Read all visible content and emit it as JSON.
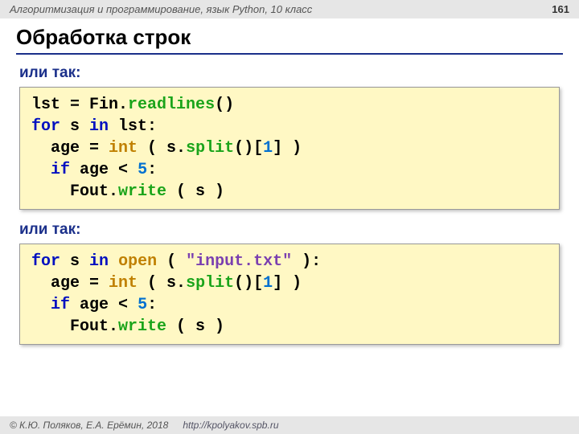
{
  "header": {
    "course": "Алгоритмизация и программирование, язык Python, 10 класс",
    "page": "161"
  },
  "title": "Обработка строк",
  "subtitle1": "или так:",
  "subtitle2": "или так:",
  "code1": {
    "l1a": "lst",
    "l1b": " = ",
    "l1c": "Fin.",
    "l1d": "readlines",
    "l1e": "()",
    "l2a": "for",
    "l2b": " s ",
    "l2c": "in",
    "l2d": " lst:",
    "l3a": "  age",
    "l3b": " = ",
    "l3c": "int",
    "l3d": " ( s.",
    "l3e": "split",
    "l3f": "()[",
    "l3g": "1",
    "l3h": "] )",
    "l4a": "  ",
    "l4b": "if",
    "l4c": " age",
    "l4d": " < ",
    "l4e": "5",
    "l4f": ":",
    "l5a": "    Fout.",
    "l5b": "write",
    "l5c": " ( s )"
  },
  "code2": {
    "l1a": "for",
    "l1b": " s ",
    "l1c": "in",
    "l1d": " ",
    "l1e": "open",
    "l1f": " ( ",
    "l1g": "\"input.txt\"",
    "l1h": " ):",
    "l2a": "  age",
    "l2b": " = ",
    "l2c": "int",
    "l2d": " ( s.",
    "l2e": "split",
    "l2f": "()[",
    "l2g": "1",
    "l2h": "] )",
    "l3a": "  ",
    "l3b": "if",
    "l3c": " age",
    "l3d": " < ",
    "l3e": "5",
    "l3f": ":",
    "l4a": "    Fout.",
    "l4b": "write",
    "l4c": " ( s )"
  },
  "footer": {
    "copyright": "© К.Ю. Поляков, Е.А. Ерёмин, 2018",
    "url": "http://kpolyakov.spb.ru"
  }
}
